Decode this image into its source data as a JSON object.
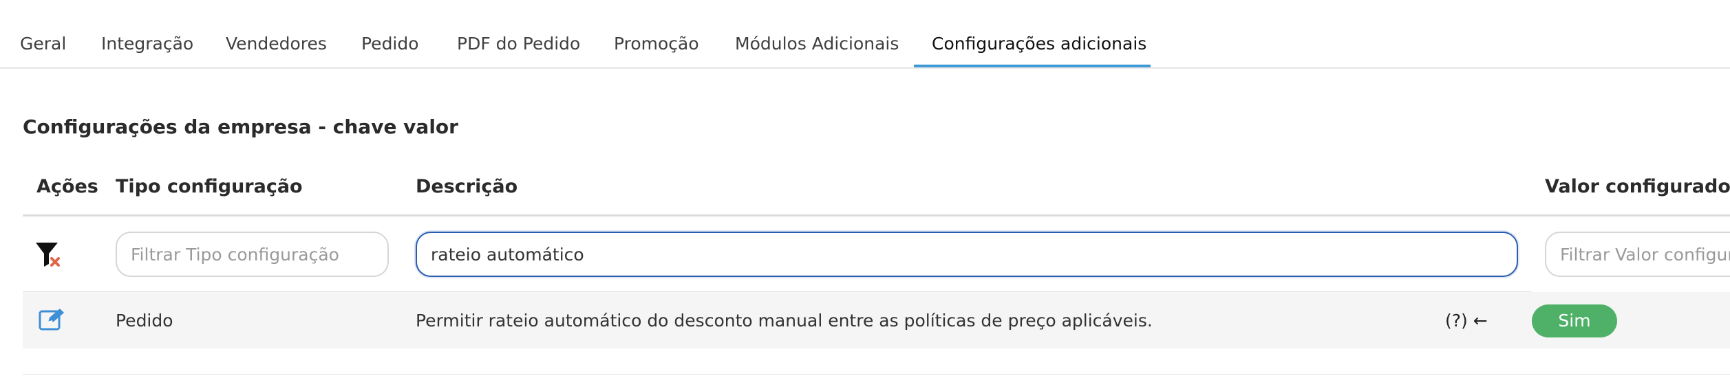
{
  "tabs": [
    {
      "label": "Geral"
    },
    {
      "label": "Integração"
    },
    {
      "label": "Vendedores"
    },
    {
      "label": "Pedido"
    },
    {
      "label": "PDF do Pedido"
    },
    {
      "label": "Promoção"
    },
    {
      "label": "Módulos Adicionais"
    },
    {
      "label": "Configurações adicionais",
      "active": true
    }
  ],
  "section": {
    "title": "Configurações da empresa - chave valor"
  },
  "table": {
    "columns": [
      "Ações",
      "Tipo configuração",
      "Descrição",
      "Valor configurado"
    ],
    "filters": {
      "tipo_placeholder": "Filtrar Tipo configuração",
      "descricao_value": "rateio automático",
      "valor_placeholder": "Filtrar Valor configurado"
    },
    "rows": [
      {
        "tipo": "Pedido",
        "descricao": "Permitir rateio automático do desconto manual entre as políticas de preço aplicáveis.",
        "help": "(?) ←",
        "valor": "Sim"
      }
    ]
  },
  "icons": {
    "clear_filter": "filter-clear-icon",
    "edit": "edit-icon"
  },
  "colors": {
    "active_tab_underline": "#3d9ad6",
    "focus_border": "#2a5db0",
    "badge_green": "#4fb168",
    "row_background": "#f5f5f5"
  }
}
